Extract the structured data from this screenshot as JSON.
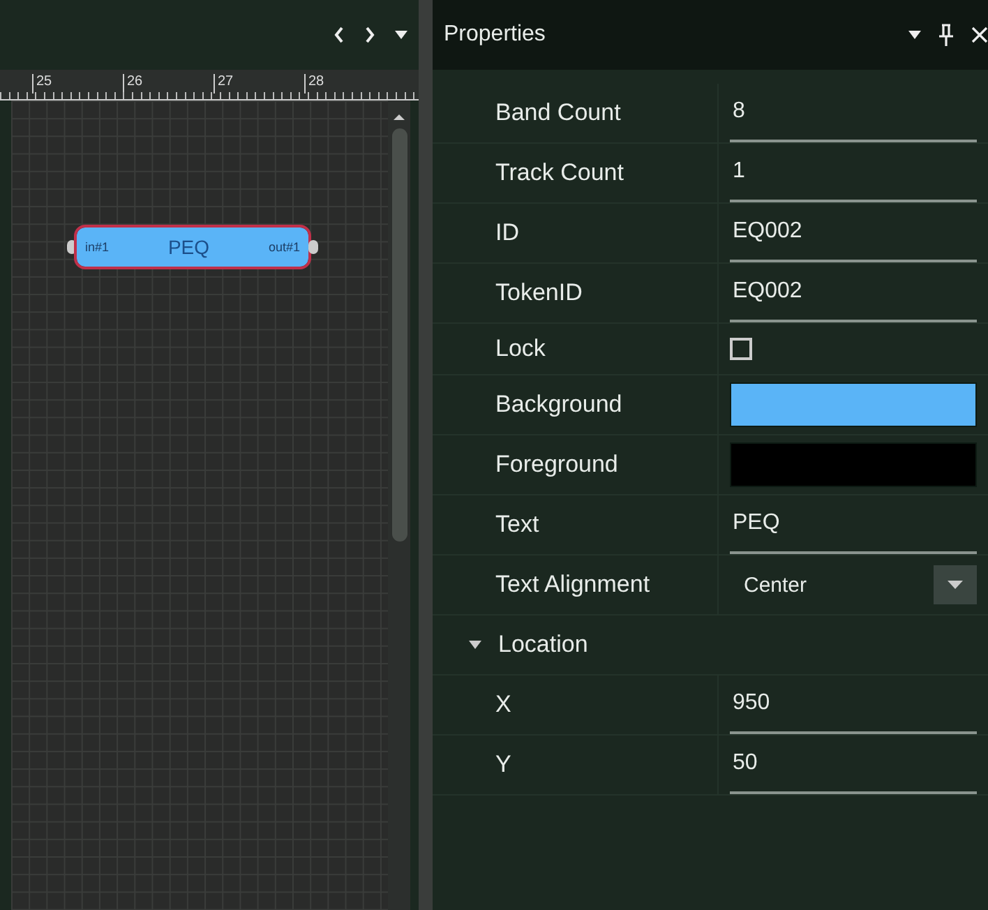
{
  "canvas": {
    "ruler_labels": [
      "25",
      "26",
      "27",
      "28"
    ],
    "node": {
      "title": "PEQ",
      "input": "in#1",
      "output": "out#1",
      "selected": true
    }
  },
  "properties": {
    "title": "Properties",
    "rows": [
      {
        "kind": "text",
        "label": "Band Count",
        "value": "8"
      },
      {
        "kind": "text",
        "label": "Track Count",
        "value": "1"
      },
      {
        "kind": "text",
        "label": "ID",
        "value": "EQ002"
      },
      {
        "kind": "text",
        "label": "TokenID",
        "value": "EQ002"
      },
      {
        "kind": "checkbox",
        "label": "Lock",
        "checked": false
      },
      {
        "kind": "color",
        "label": "Background",
        "color": "#5ab4f7"
      },
      {
        "kind": "color",
        "label": "Foreground",
        "color": "#000000"
      },
      {
        "kind": "text",
        "label": "Text",
        "value": "PEQ"
      },
      {
        "kind": "dropdown",
        "label": "Text Alignment",
        "value": "Center"
      },
      {
        "kind": "group",
        "label": "Location",
        "expanded": true,
        "children": [
          {
            "kind": "text",
            "label": "X",
            "value": "950"
          },
          {
            "kind": "text",
            "label": "Y",
            "value": "50"
          }
        ]
      }
    ]
  }
}
